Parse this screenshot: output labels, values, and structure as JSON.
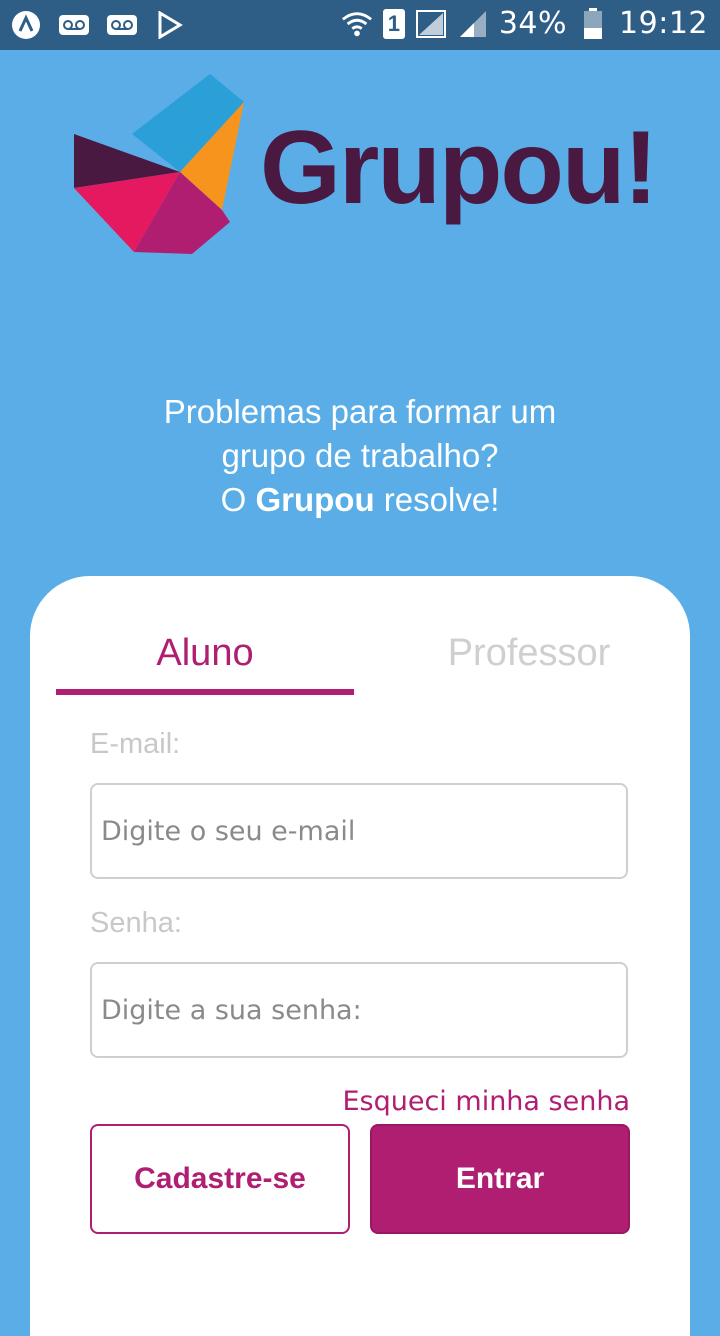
{
  "status_bar": {
    "sim": "1",
    "battery": "34%",
    "time": "19:12"
  },
  "logo": {
    "text": "Grupou!"
  },
  "tagline": {
    "line1": "Problemas para formar um",
    "line2": "grupo de trabalho?",
    "line3_prefix": "O ",
    "line3_brand": "Grupou",
    "line3_suffix": " resolve!"
  },
  "tabs": [
    {
      "label": "Aluno",
      "active": true
    },
    {
      "label": "Professor",
      "active": false
    }
  ],
  "form": {
    "email_label": "E-mail:",
    "email_placeholder": "Digite o seu e-mail",
    "password_label": "Senha:",
    "password_placeholder": "Digite a sua senha:",
    "forgot": "Esqueci minha senha",
    "register_button": "Cadastre-se",
    "login_button": "Entrar"
  },
  "colors": {
    "background": "#5aade6",
    "status_bar": "#2e5d86",
    "accent": "#b01e72",
    "brand_text": "#4a1942"
  }
}
